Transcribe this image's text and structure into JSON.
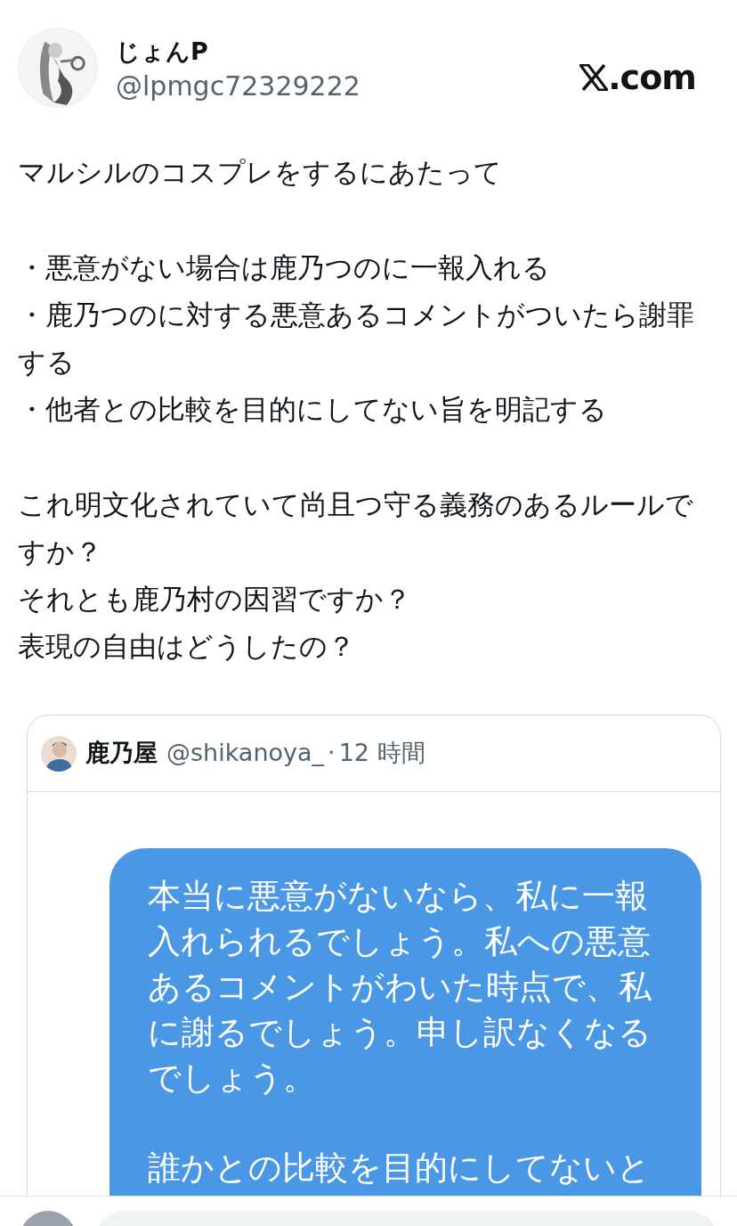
{
  "author": {
    "name": "じょんP",
    "handle": "@lpmgc72329222"
  },
  "site": {
    "label": ".com"
  },
  "post": {
    "paragraphs": [
      [
        "マルシルのコスプレをするにあたって"
      ],
      [
        "・悪意がない場合は鹿乃つのに一報入れる",
        "・鹿乃つのに対する悪意あるコメントがついたら謝罪する",
        "・他者との比較を目的にしてない旨を明記する"
      ],
      [
        "これ明文化されていて尚且つ守る義務のあるルールですか？",
        "それとも鹿乃村の因習ですか？",
        "表現の自由はどうしたの？"
      ]
    ]
  },
  "quote": {
    "name": "鹿乃屋",
    "handle": "@shikanoya_",
    "separator": "·",
    "time": "12 時間",
    "bubble": {
      "paragraphs": [
        [
          "本当に悪意がないなら、私に一報",
          "入れられるでしょう。私への悪意",
          "あるコメントがわいた時点で、私",
          "に謝るでしょう。申し訳なくなる",
          "でしょう。"
        ],
        [
          "誰かとの比較を目的にしてないと"
        ]
      ]
    }
  }
}
